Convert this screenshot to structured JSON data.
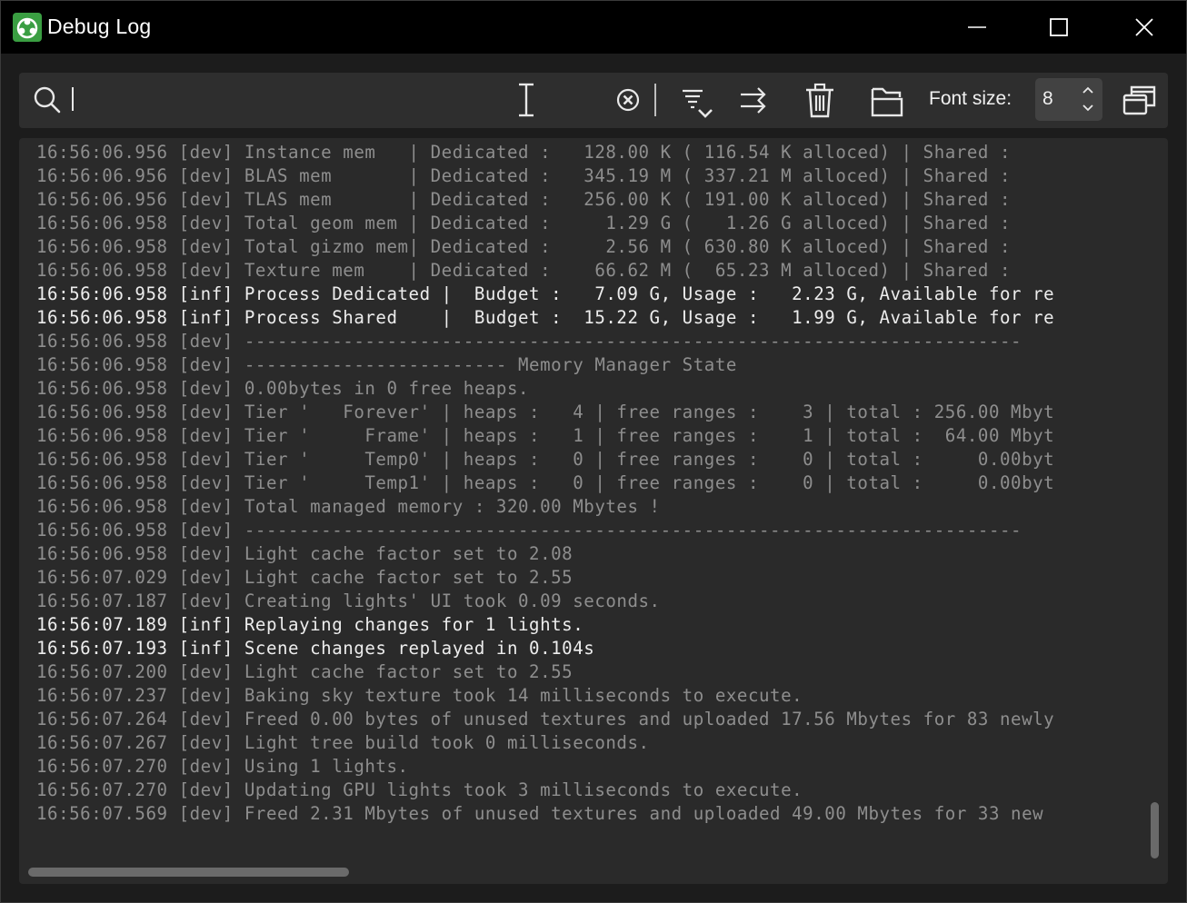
{
  "window": {
    "title": "Debug Log",
    "icons": {
      "app": "app-logo-icon",
      "minimize": "minimize-icon",
      "maximize": "maximize-icon",
      "close": "close-icon"
    }
  },
  "toolbar": {
    "search": {
      "value": "",
      "placeholder": ""
    },
    "icons": [
      "search-icon",
      "text-cursor-icon",
      "clear-search-icon",
      "filter-icon",
      "word-wrap-icon",
      "delete-icon",
      "open-folder-icon",
      "detach-window-icon"
    ],
    "font_size_label": "Font size:",
    "font_size_value": "8"
  },
  "colors": {
    "dev": "#8e8e8e",
    "inf": "#ededed",
    "panel": "#2a2a2a",
    "titlebar": "#000000",
    "accent": "#3a9e42"
  },
  "log": [
    {
      "level": "dev",
      "text": "16:56:06.956 [dev] Instance mem   | Dedicated :   128.00 K ( 116.54 K alloced) | Shared :"
    },
    {
      "level": "dev",
      "text": "16:56:06.956 [dev] BLAS mem       | Dedicated :   345.19 M ( 337.21 M alloced) | Shared :"
    },
    {
      "level": "dev",
      "text": "16:56:06.956 [dev] TLAS mem       | Dedicated :   256.00 K ( 191.00 K alloced) | Shared :"
    },
    {
      "level": "dev",
      "text": "16:56:06.958 [dev] Total geom mem | Dedicated :     1.29 G (   1.26 G alloced) | Shared :"
    },
    {
      "level": "dev",
      "text": "16:56:06.958 [dev] Total gizmo mem| Dedicated :     2.56 M ( 630.80 K alloced) | Shared :"
    },
    {
      "level": "dev",
      "text": "16:56:06.958 [dev] Texture mem    | Dedicated :    66.62 M (  65.23 M alloced) | Shared :"
    },
    {
      "level": "inf",
      "text": "16:56:06.958 [inf] Process Dedicated |  Budget :   7.09 G, Usage :   2.23 G, Available for re"
    },
    {
      "level": "inf",
      "text": "16:56:06.958 [inf] Process Shared    |  Budget :  15.22 G, Usage :   1.99 G, Available for re"
    },
    {
      "level": "dev",
      "text": "16:56:06.958 [dev] -----------------------------------------------------------------------"
    },
    {
      "level": "dev",
      "text": "16:56:06.958 [dev] ------------------------ Memory Manager State"
    },
    {
      "level": "dev",
      "text": "16:56:06.958 [dev] 0.00bytes in 0 free heaps."
    },
    {
      "level": "dev",
      "text": "16:56:06.958 [dev] Tier '   Forever' | heaps :   4 | free ranges :    3 | total : 256.00 Mbyt"
    },
    {
      "level": "dev",
      "text": "16:56:06.958 [dev] Tier '     Frame' | heaps :   1 | free ranges :    1 | total :  64.00 Mbyt"
    },
    {
      "level": "dev",
      "text": "16:56:06.958 [dev] Tier '     Temp0' | heaps :   0 | free ranges :    0 | total :     0.00byt"
    },
    {
      "level": "dev",
      "text": "16:56:06.958 [dev] Tier '     Temp1' | heaps :   0 | free ranges :    0 | total :     0.00byt"
    },
    {
      "level": "dev",
      "text": "16:56:06.958 [dev] Total managed memory : 320.00 Mbytes !"
    },
    {
      "level": "dev",
      "text": "16:56:06.958 [dev] -----------------------------------------------------------------------"
    },
    {
      "level": "dev",
      "text": "16:56:06.958 [dev] Light cache factor set to 2.08"
    },
    {
      "level": "dev",
      "text": "16:56:07.029 [dev] Light cache factor set to 2.55"
    },
    {
      "level": "dev",
      "text": "16:56:07.187 [dev] Creating lights' UI took 0.09 seconds."
    },
    {
      "level": "inf",
      "text": "16:56:07.189 [inf] Replaying changes for 1 lights."
    },
    {
      "level": "inf",
      "text": "16:56:07.193 [inf] Scene changes replayed in 0.104s"
    },
    {
      "level": "dev",
      "text": "16:56:07.200 [dev] Light cache factor set to 2.55"
    },
    {
      "level": "dev",
      "text": "16:56:07.237 [dev] Baking sky texture took 14 milliseconds to execute."
    },
    {
      "level": "dev",
      "text": "16:56:07.264 [dev] Freed 0.00 bytes of unused textures and uploaded 17.56 Mbytes for 83 newly"
    },
    {
      "level": "dev",
      "text": "16:56:07.267 [dev] Light tree build took 0 milliseconds."
    },
    {
      "level": "dev",
      "text": "16:56:07.270 [dev] Using 1 lights."
    },
    {
      "level": "dev",
      "text": "16:56:07.270 [dev] Updating GPU lights took 3 milliseconds to execute."
    },
    {
      "level": "dev",
      "text": "16:56:07.569 [dev] Freed 2.31 Mbytes of unused textures and uploaded 49.00 Mbytes for 33 new"
    }
  ]
}
